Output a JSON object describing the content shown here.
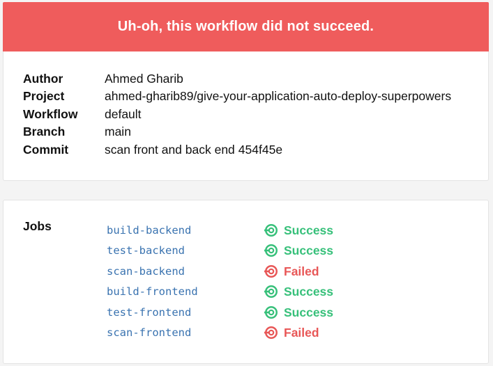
{
  "banner": {
    "title": "Uh-oh, this workflow did not succeed."
  },
  "details": [
    {
      "label": "Author",
      "value": "Ahmed Gharib",
      "is_link": true
    },
    {
      "label": "Project",
      "value": "ahmed-gharib89/give-your-application-auto-deploy-superpowers",
      "is_link": true
    },
    {
      "label": "Workflow",
      "value": "default",
      "is_link": true
    },
    {
      "label": "Branch",
      "value": "main",
      "is_link": true
    },
    {
      "label": "Commit",
      "value": "scan front and back end",
      "commit_hash": "454f45e"
    }
  ],
  "jobs": {
    "label": "Jobs",
    "items": [
      {
        "name": "build-backend",
        "status": "Success",
        "state": "success"
      },
      {
        "name": "test-backend",
        "status": "Success",
        "state": "success"
      },
      {
        "name": "scan-backend",
        "status": "Failed",
        "state": "failed"
      },
      {
        "name": "build-frontend",
        "status": "Success",
        "state": "success"
      },
      {
        "name": "test-frontend",
        "status": "Success",
        "state": "success"
      },
      {
        "name": "scan-frontend",
        "status": "Failed",
        "state": "failed"
      }
    ]
  },
  "colors": {
    "banner": "#ef5c5c",
    "link": "#3a73b0",
    "success": "#37c07a",
    "failed": "#e85757"
  },
  "icons": {
    "status": "circleci-logo-icon"
  }
}
